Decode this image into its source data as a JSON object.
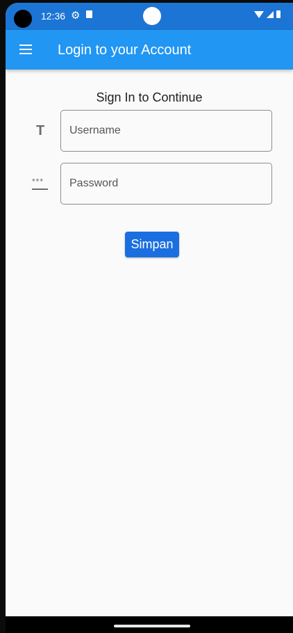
{
  "status_bar": {
    "time": "12:36",
    "gear_glyph": "⚙"
  },
  "app_bar": {
    "title": "Login to your Account"
  },
  "form": {
    "heading": "Sign In to Continue",
    "username_placeholder": "Username",
    "username_value": "",
    "username_icon": "T",
    "password_placeholder": "Password",
    "password_value": "",
    "password_icon": "***",
    "submit_label": "Simpan"
  },
  "colors": {
    "status_bar": "#1c75d4",
    "app_bar": "#2196f3",
    "button": "#1b6ee0",
    "background": "#fafafa"
  }
}
